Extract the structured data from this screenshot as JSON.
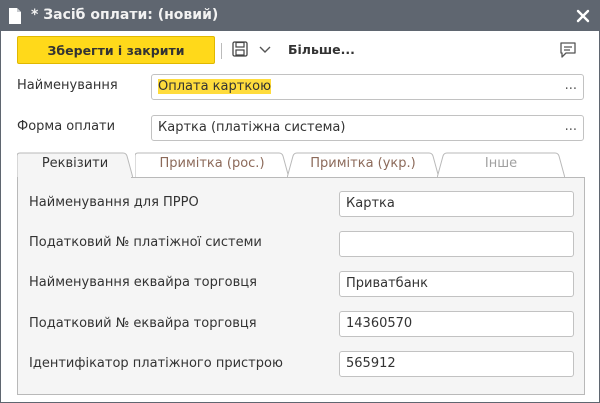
{
  "window": {
    "title": "* Засіб оплати: (новий)"
  },
  "toolbar": {
    "save_label": "Зберегти і закрити",
    "more_label": "Більше..."
  },
  "fields": {
    "name": {
      "label": "Найменування",
      "value": "Оплата карткою"
    },
    "payment_form": {
      "label": "Форма оплати",
      "value": "Картка (платіжна система)"
    }
  },
  "tabs": [
    {
      "label": "Реквізити",
      "active": true
    },
    {
      "label": "Примітка (рос.)",
      "active": false
    },
    {
      "label": "Примітка (укр.)",
      "active": false
    },
    {
      "label": "Інше",
      "active": false
    }
  ],
  "details": [
    {
      "label": "Найменування для ПРРО",
      "value": "Картка"
    },
    {
      "label": "Податковий № платіжної системи",
      "value": ""
    },
    {
      "label": "Найменування еквайра торговця",
      "value": "Приватбанк"
    },
    {
      "label": "Податковий № еквайра торговця",
      "value": "14360570"
    },
    {
      "label": "Ідентифікатор платіжного пристрою",
      "value": "565912"
    }
  ],
  "colors": {
    "titlebar": "#5f6670",
    "accent": "#ffd91a",
    "highlight": "#ffdc3c"
  },
  "icons": {
    "title": "document-icon",
    "close": "close-icon",
    "save": "floppy-disk-icon",
    "dropdown": "chevron-down-icon",
    "comment": "comment-icon"
  }
}
